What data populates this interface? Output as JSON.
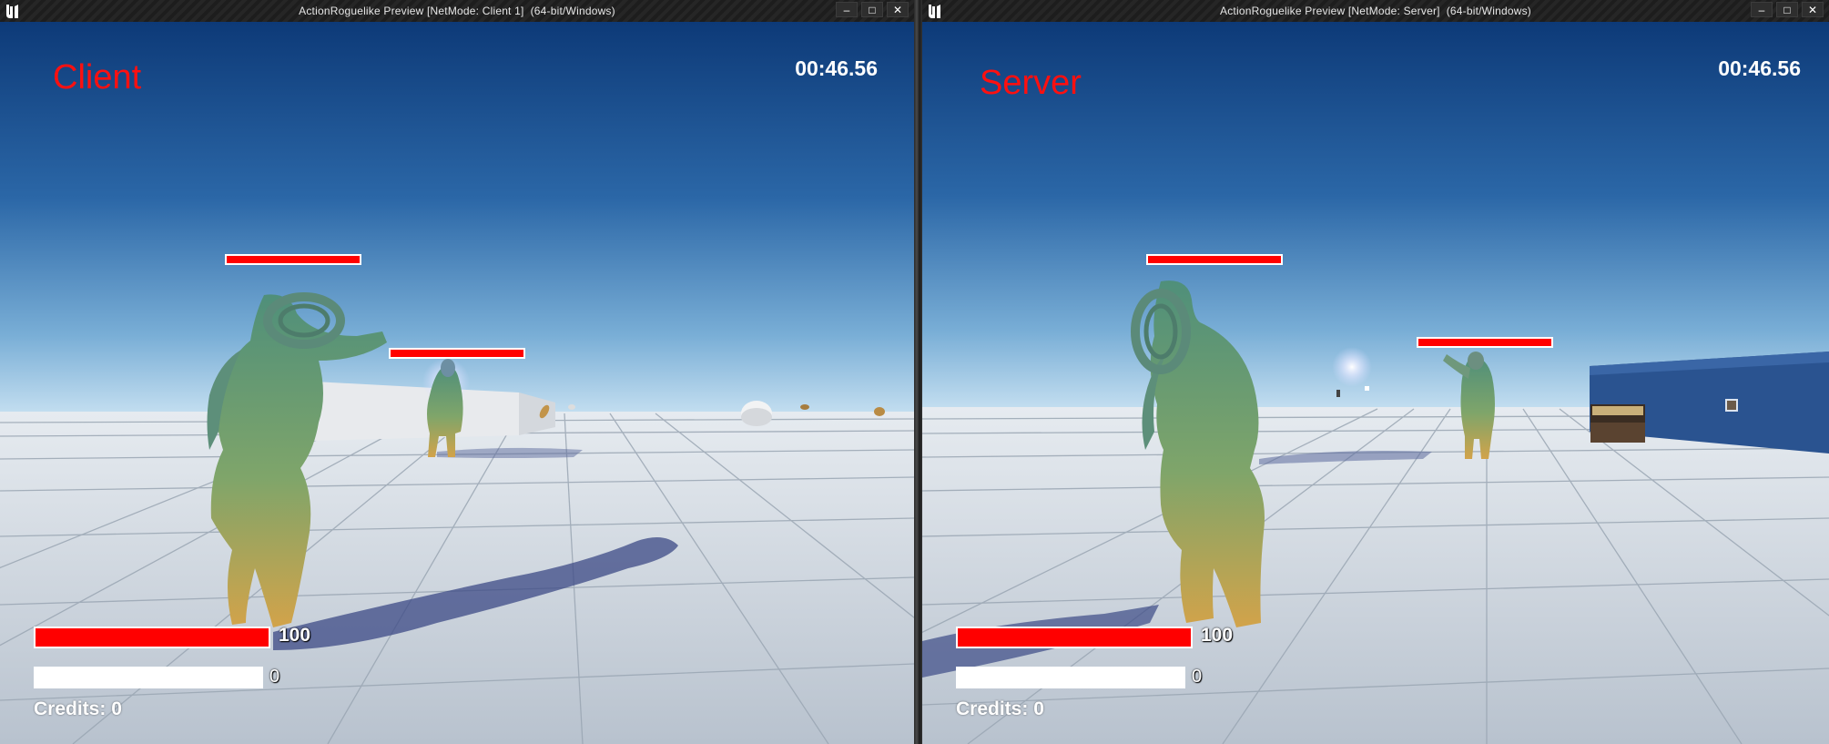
{
  "client": {
    "window_title": "ActionRoguelike Preview [NetMode: Client 1]  (64-bit/Windows)",
    "net_label": "Client",
    "timer": "00:46.56",
    "health_value": "100",
    "health_fraction": 1.0,
    "rage_value": "0",
    "credits_label": "Credits:",
    "credits_value": "0"
  },
  "server": {
    "window_title": "ActionRoguelike Preview [NetMode: Server]  (64-bit/Windows)",
    "net_label": "Server",
    "timer": "00:46.56",
    "health_value": "100",
    "health_fraction": 1.0,
    "rage_value": "0",
    "credits_label": "Credits:",
    "credits_value": "0"
  },
  "window_buttons": {
    "minimize": "–",
    "maximize": "□",
    "close": "✕"
  },
  "icons": {
    "engine_logo": "unreal-engine-logo-icon"
  },
  "colors": {
    "net_label": "#ff1010",
    "health_fill": "#ff0000",
    "rage_fill": "#ffffff",
    "sky_top": "#0d3a78",
    "sky_horizon": "#b9d9ee",
    "floor": "#c9d2dc"
  }
}
